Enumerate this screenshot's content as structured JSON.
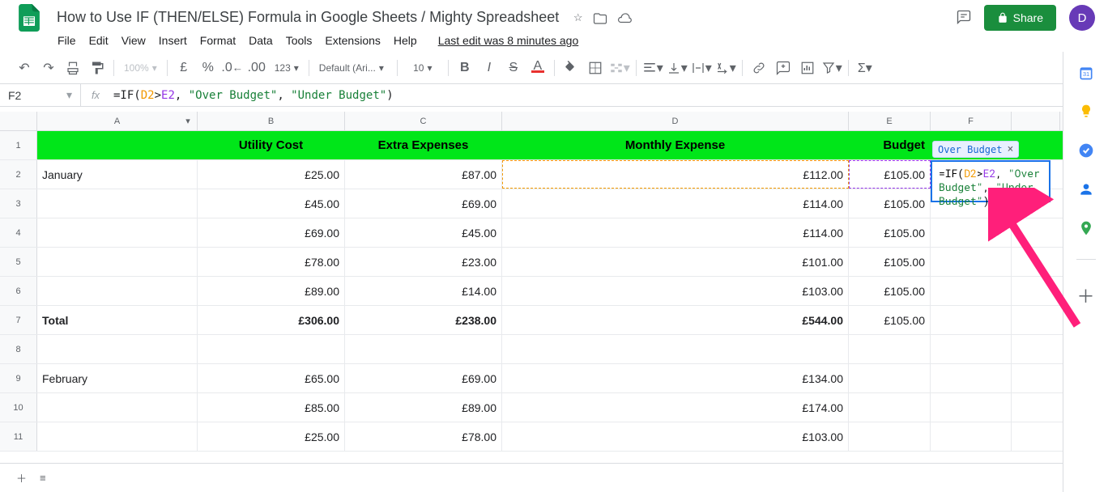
{
  "doc": {
    "title": "How to Use IF (THEN/ELSE) Formula in Google Sheets / Mighty Spreadsheet",
    "last_edit": "Last edit was 8 minutes ago"
  },
  "actions": {
    "share": "Share",
    "avatar_letter": "D"
  },
  "menu": [
    "File",
    "Edit",
    "View",
    "Insert",
    "Format",
    "Data",
    "Tools",
    "Extensions",
    "Help"
  ],
  "toolbar": {
    "zoom": "100%",
    "font": "Default (Ari...",
    "font_size": "10",
    "currency": "£",
    "percent": "%",
    "decimal_format": "123"
  },
  "formula_bar": {
    "cell_ref": "F2",
    "formula_plain": "=IF(D2>E2, \"Over Budget\", \"Under Budget\")",
    "fn_open": "=IF(",
    "ref1": "D2",
    "gt": ">",
    "ref2": "E2",
    "c1": ", ",
    "str1": "\"Over Budget\"",
    "c2": ", ",
    "str2": "\"Under Budget\"",
    "close": ")"
  },
  "cols": [
    "A",
    "B",
    "C",
    "D",
    "E",
    "F"
  ],
  "header_row": {
    "a": "",
    "b": "Utility Cost",
    "c": "Extra Expenses",
    "d": "Monthly Expense",
    "e": "Budget",
    "f": ""
  },
  "rows": [
    {
      "n": "2",
      "a": "January",
      "b": "£25.00",
      "c": "£87.00",
      "d": "£112.00",
      "e": "£105.00",
      "bold": false,
      "ants": true
    },
    {
      "n": "3",
      "a": "",
      "b": "£45.00",
      "c": "£69.00",
      "d": "£114.00",
      "e": "£105.00",
      "bold": false
    },
    {
      "n": "4",
      "a": "",
      "b": "£69.00",
      "c": "£45.00",
      "d": "£114.00",
      "e": "£105.00",
      "bold": false
    },
    {
      "n": "5",
      "a": "",
      "b": "£78.00",
      "c": "£23.00",
      "d": "£101.00",
      "e": "£105.00",
      "bold": false
    },
    {
      "n": "6",
      "a": "",
      "b": "£89.00",
      "c": "£14.00",
      "d": "£103.00",
      "e": "£105.00",
      "bold": false
    },
    {
      "n": "7",
      "a": "Total",
      "b": "£306.00",
      "c": "£238.00",
      "d": "£544.00",
      "e": "£105.00",
      "bold": true
    },
    {
      "n": "8",
      "a": "",
      "b": "",
      "c": "",
      "d": "",
      "e": "",
      "bold": false
    },
    {
      "n": "9",
      "a": "February",
      "b": "£65.00",
      "c": "£69.00",
      "d": "£134.00",
      "e": "",
      "bold": false
    },
    {
      "n": "10",
      "a": "",
      "b": "£85.00",
      "c": "£89.00",
      "d": "£174.00",
      "e": "",
      "bold": false
    },
    {
      "n": "11",
      "a": "",
      "b": "£25.00",
      "c": "£78.00",
      "d": "£103.00",
      "e": "",
      "bold": false
    }
  ],
  "popup": {
    "result": "Over Budget",
    "line1a": "=IF(",
    "line1_ref1": "D2",
    "line1_gt": ">",
    "line1_ref2": "E2",
    "line1_c": ", ",
    "line1_str1": "\"Over ",
    "line2_str1": "Budget\"",
    "line2_c": ", ",
    "line2_str2": "\"Under ",
    "line3_str2": "Budget\"",
    "line3_close": ")"
  }
}
